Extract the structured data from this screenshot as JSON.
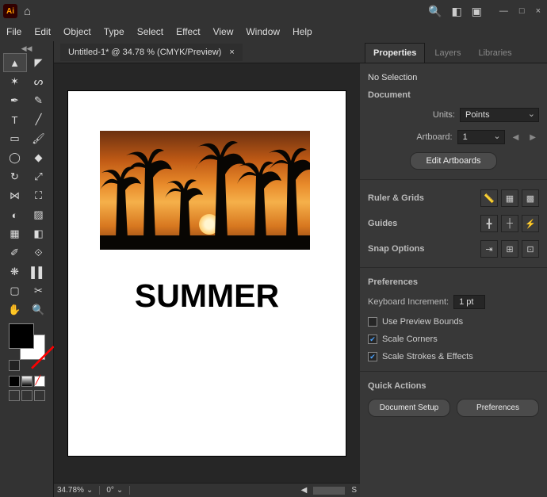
{
  "titlebar": {
    "app_abbrev": "Ai",
    "win_min": "—",
    "win_max": "□",
    "win_close": "×"
  },
  "menubar": [
    "File",
    "Edit",
    "Object",
    "Type",
    "Select",
    "Effect",
    "View",
    "Window",
    "Help"
  ],
  "document": {
    "tab_title": "Untitled-1* @ 34.78 % (CMYK/Preview)",
    "tab_close": "×"
  },
  "canvas": {
    "headline": "SUMMER"
  },
  "statusbar": {
    "zoom": "34.78%",
    "rotation": "0°",
    "right": "S"
  },
  "panel": {
    "tabs": {
      "properties": "Properties",
      "layers": "Layers",
      "libraries": "Libraries"
    },
    "no_selection": "No Selection",
    "doc_header": "Document",
    "units_label": "Units:",
    "units_value": "Points",
    "artboard_label": "Artboard:",
    "artboard_value": "1",
    "edit_artboards": "Edit Artboards",
    "ruler_label": "Ruler & Grids",
    "guides_label": "Guides",
    "snap_label": "Snap Options",
    "prefs_header": "Preferences",
    "kbd_label": "Keyboard Increment:",
    "kbd_value": "1 pt",
    "chk_preview": "Use Preview Bounds",
    "chk_corners": "Scale Corners",
    "chk_strokes": "Scale Strokes & Effects",
    "qa_header": "Quick Actions",
    "qa_docsetup": "Document Setup",
    "qa_prefs": "Preferences"
  }
}
